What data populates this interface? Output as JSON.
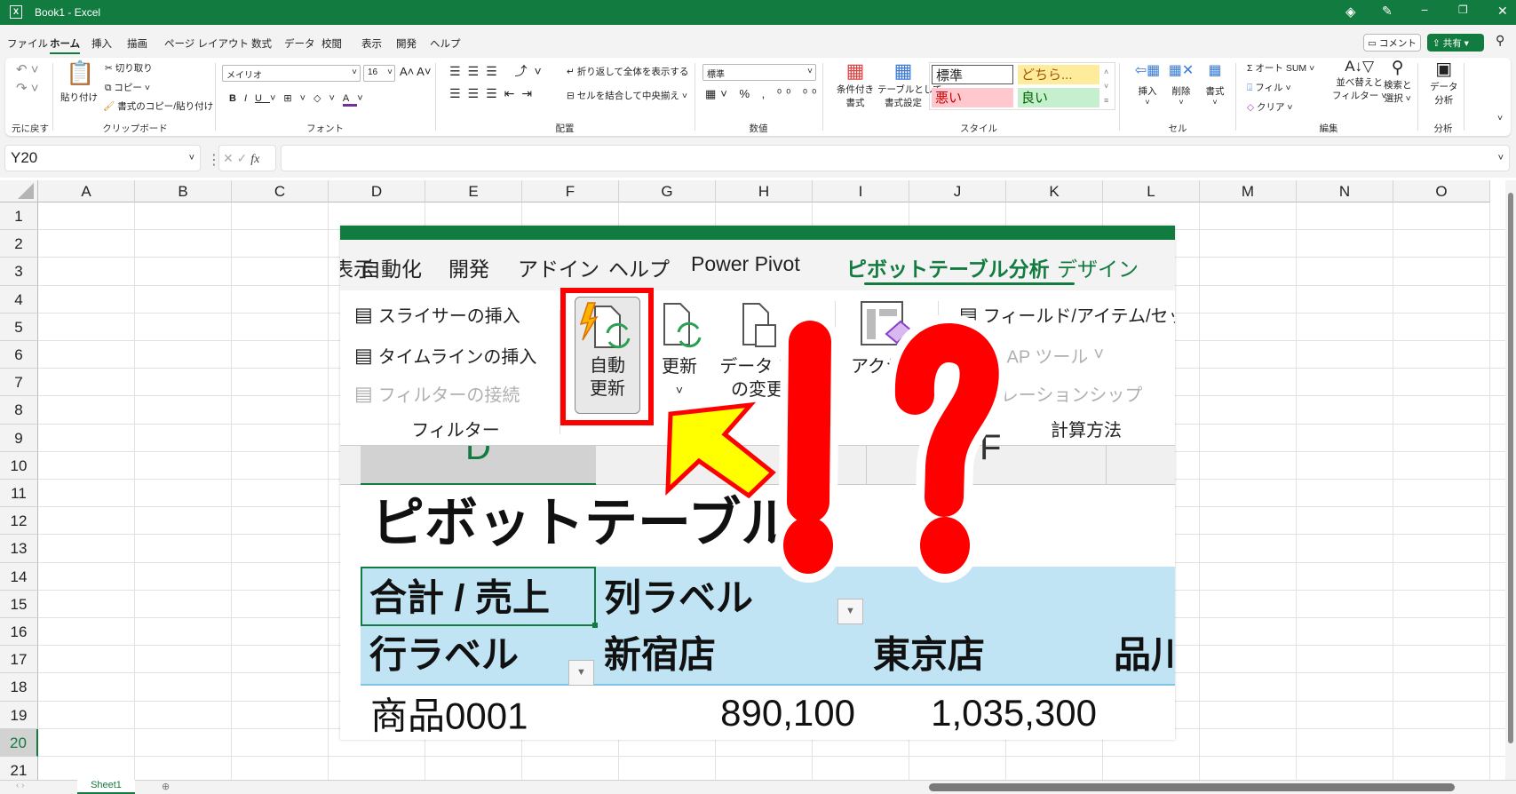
{
  "window": {
    "title": "Book1  -  Excel",
    "controls": [
      "minimize",
      "restore",
      "close"
    ]
  },
  "menu": {
    "tabs": [
      "ファイル",
      "ホーム",
      "挿入",
      "描画",
      "ページ レイアウト",
      "数式",
      "データ",
      "校閲",
      "表示",
      "開発",
      "ヘルプ"
    ],
    "active": 1,
    "comment": "コメント",
    "share": "共有"
  },
  "ribbon": {
    "groups": [
      "元に戻す",
      "クリップボード",
      "フォント",
      "配置",
      "数値",
      "スタイル",
      "セル",
      "編集",
      "分析"
    ],
    "clipboard": {
      "paste": "貼り付け",
      "cut": "切り取り",
      "copy": "コピー",
      "format_painter": "書式のコピー/貼り付け"
    },
    "font": {
      "name": "メイリオ",
      "size": "16"
    },
    "alignment": {
      "wrap": "折り返して全体を表示する",
      "merge": "セルを結合して中央揃え"
    },
    "number": {
      "format": "標準"
    },
    "styles": {
      "conditional": [
        "条件付き",
        "書式"
      ],
      "table": [
        "テーブルとして",
        "書式設定"
      ],
      "cells": [
        "標準",
        "どちら...",
        "悪い",
        "良い"
      ]
    },
    "cells": [
      "挿入",
      "削除",
      "書式"
    ],
    "editing": {
      "autosum": "オート SUM",
      "fill": "フィル",
      "clear": "クリア",
      "sort": [
        "並べ替えと",
        "フィルター"
      ],
      "find": [
        "検索と",
        "選択"
      ]
    },
    "analysis": [
      "データ",
      "分析"
    ]
  },
  "formula_bar": {
    "name_box": "Y20",
    "fx": "fx",
    "value": ""
  },
  "sheet": {
    "columns": [
      "A",
      "B",
      "C",
      "D",
      "E",
      "F",
      "G",
      "H",
      "I",
      "J",
      "K",
      "L",
      "M",
      "N",
      "O"
    ],
    "rows": [
      "1",
      "2",
      "3",
      "4",
      "5",
      "6",
      "7",
      "8",
      "9",
      "10",
      "11",
      "12",
      "13",
      "14",
      "15",
      "16",
      "17",
      "18",
      "19",
      "20",
      "21"
    ],
    "selected_row": "20",
    "tabs": [
      "Sheet1"
    ]
  },
  "overlay": {
    "tabs": [
      "表示",
      "自動化",
      "開発",
      "アドイン",
      "ヘルプ",
      "Power Pivot",
      "ピボットテーブル分析",
      "デザイン"
    ],
    "active_tab": "ピボットテーブル分析",
    "filter_items": [
      "スライサーの挿入",
      "タイムラインの挿入",
      "フィルターの接続"
    ],
    "filter_group": "フィルター",
    "auto_refresh": [
      "自動",
      "更新"
    ],
    "refresh": "更新",
    "data_source": [
      "データ ソ",
      "の変更"
    ],
    "action": "アクシ",
    "calc_items": [
      "フィールド/アイテム/セット",
      "OLAP ツール",
      "リレーションシップ"
    ],
    "calc_group": "計算方法",
    "col_headers": [
      "D",
      "F"
    ],
    "pivot_title": "ピボットテーブル",
    "pivot": {
      "values_label": "合計 / 売上",
      "col_label": "列ラベル",
      "row_label": "行ラベル",
      "stores": [
        "新宿店",
        "東京店",
        "品川"
      ],
      "rows": [
        {
          "item": "商品0001",
          "values": [
            "890,100",
            "1,035,300"
          ]
        }
      ]
    },
    "highlight_color": "#ff0000",
    "arrow_color": "#ffff00",
    "pivot_fill": "#c0e4f4"
  }
}
